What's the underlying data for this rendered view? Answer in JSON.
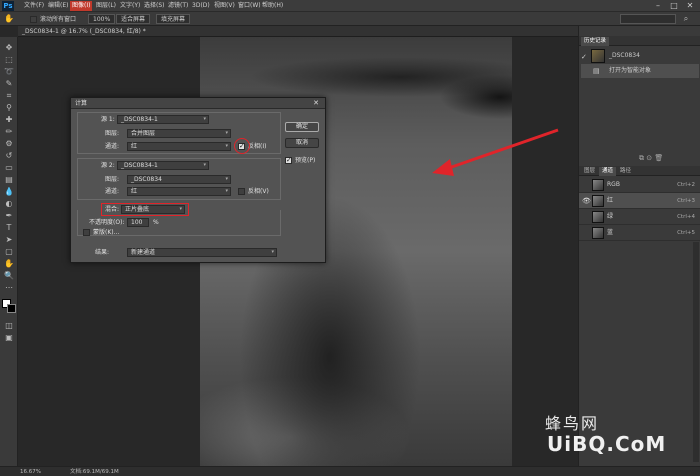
{
  "app": {
    "logo": "Ps"
  },
  "menu": [
    {
      "label": "文件(F)",
      "active": false
    },
    {
      "label": "编辑(E)",
      "active": false
    },
    {
      "label": "图像(I)",
      "active": true
    },
    {
      "label": "图层(L)",
      "active": false
    },
    {
      "label": "文字(Y)",
      "active": false
    },
    {
      "label": "选择(S)",
      "active": false
    },
    {
      "label": "滤镜(T)",
      "active": false
    },
    {
      "label": "3D(D)",
      "active": false
    },
    {
      "label": "视图(V)",
      "active": false
    },
    {
      "label": "窗口(W)",
      "active": false
    },
    {
      "label": "帮助(H)",
      "active": false
    }
  ],
  "options": {
    "scroll_all": "滚动所有窗口",
    "zoom": "100%",
    "fit_screen": "适合屏幕",
    "fill_screen": "填充屏幕"
  },
  "doc_tab": {
    "title": "_DSC0834-1 @ 16.7% (_DSC0834, 红/8) *"
  },
  "dialog": {
    "title": "计算",
    "source1": {
      "label": "源 1:",
      "file": "_DSC0834-1",
      "layer_label": "图层:",
      "layer": "合并图层",
      "channel_label": "通道:",
      "channel": "红",
      "invert_label": "反相(I)",
      "invert": true
    },
    "source2": {
      "label": "源 2:",
      "file": "_DSC0834-1",
      "layer_label": "图层:",
      "layer": "_DSC0834",
      "channel_label": "通道:",
      "channel": "红",
      "invert_label": "反相(V)",
      "invert": false
    },
    "blend": {
      "label": "混合:",
      "mode": "正片叠底",
      "opacity_label": "不透明度(O):",
      "opacity": "100",
      "opacity_unit": "%",
      "mask_label": "蒙版(K)..."
    },
    "result": {
      "label": "结果:",
      "value": "新建通道"
    },
    "ok_label": "确定",
    "cancel_label": "取消",
    "preview_label": "预览(P)",
    "preview": true
  },
  "history": {
    "tabs": [
      "历史记录"
    ],
    "rows": [
      {
        "label": "_DSC0834"
      },
      {
        "label": "打开为智能对象"
      }
    ]
  },
  "channels": {
    "tabs": [
      "图层",
      "通道",
      "路径"
    ],
    "rows": [
      {
        "name": "RGB",
        "key": "Ctrl+2",
        "selected": false,
        "visible": false
      },
      {
        "name": "红",
        "key": "Ctrl+3",
        "selected": true,
        "visible": true
      },
      {
        "name": "绿",
        "key": "Ctrl+4",
        "selected": false,
        "visible": false
      },
      {
        "name": "蓝",
        "key": "Ctrl+5",
        "selected": false,
        "visible": false
      }
    ]
  },
  "status": {
    "zoom": "16.67%",
    "doc": "文档:69.1M/69.1M"
  },
  "watermark": {
    "line1": "蜂鸟网",
    "line2": "UiBQ.CoM"
  },
  "colors": {
    "annotation": "#e0242a",
    "active_menu": "#c0392b"
  }
}
